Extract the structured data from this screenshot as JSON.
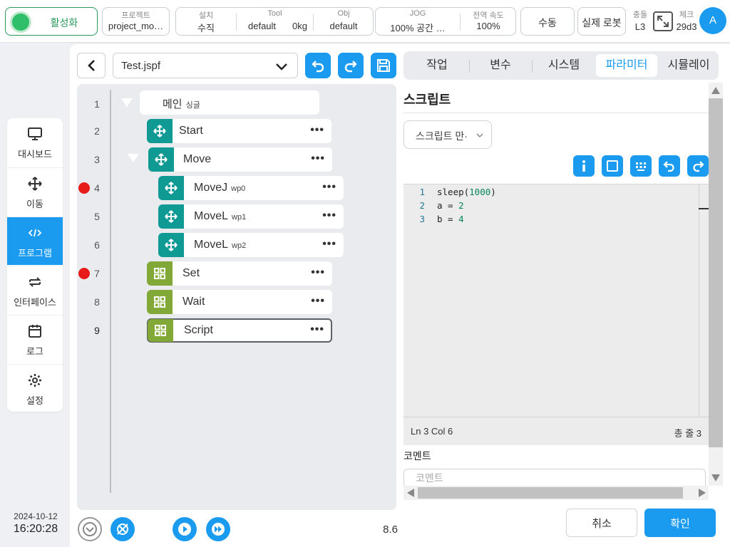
{
  "topbar": {
    "activate_label": "활성화",
    "project": {
      "label": "프로젝트",
      "value": "project_mo…"
    },
    "setup": {
      "label": "설치",
      "value": "수직"
    },
    "tool": {
      "label": "Tool",
      "value1": "default",
      "value2": "0kg"
    },
    "obj": {
      "label": "Obj",
      "value": "default"
    },
    "jog": {
      "label": "JOG",
      "value": "100%  공간 …"
    },
    "global_speed": {
      "label": "전역 속도",
      "value": "100%"
    },
    "manual_label": "수동",
    "real_robot_label": "실제 로봇",
    "collision": {
      "label": "충돌",
      "value": "L3"
    },
    "checksum": {
      "label": "체크",
      "value": "29d3"
    },
    "avatar_letter": "A",
    "colors": {
      "activate": "#2a9a5a",
      "accent": "#1a9bef"
    }
  },
  "nav": {
    "items": [
      {
        "label": "대시보드",
        "icon": "monitor-icon"
      },
      {
        "label": "이동",
        "icon": "move-icon"
      },
      {
        "label": "프로그램",
        "icon": "code-icon"
      },
      {
        "label": "인터페이스",
        "icon": "swap-icon"
      },
      {
        "label": "로그",
        "icon": "calendar-icon"
      },
      {
        "label": "설정",
        "icon": "gear-icon"
      }
    ],
    "active": "프로그램"
  },
  "datetime": {
    "date": "2024-10-12",
    "time": "16:20:28"
  },
  "editor": {
    "file_name": "Test.jspf",
    "tree": [
      {
        "line": "1",
        "name": "메인",
        "sub": "싱글",
        "type": "root"
      },
      {
        "line": "2",
        "name": "Start",
        "sub": "",
        "type": "move"
      },
      {
        "line": "3",
        "name": "Move",
        "sub": "",
        "type": "move"
      },
      {
        "line": "4",
        "name": "MoveJ",
        "sub": "wp0",
        "type": "move",
        "breakpoint": true
      },
      {
        "line": "5",
        "name": "MoveL",
        "sub": "wp1",
        "type": "move"
      },
      {
        "line": "6",
        "name": "MoveL",
        "sub": "wp2",
        "type": "move"
      },
      {
        "line": "7",
        "name": "Set",
        "sub": "",
        "type": "logic",
        "breakpoint": true
      },
      {
        "line": "8",
        "name": "Wait",
        "sub": "",
        "type": "logic"
      },
      {
        "line": "9",
        "name": "Script",
        "sub": "",
        "type": "logic",
        "selected": true
      }
    ],
    "more_label": "•••",
    "speed_value": "8.6"
  },
  "tabs": [
    "작업",
    "변수",
    "시스템",
    "파라미터",
    "시뮬레이"
  ],
  "active_tab": "파라미터",
  "script": {
    "title": "스크립트",
    "mode_value": "스크립트 만·",
    "code_lines": [
      {
        "n": "1",
        "text": "sleep(1000)"
      },
      {
        "n": "2",
        "text": "a = 2"
      },
      {
        "n": "3",
        "text": "b = 4"
      }
    ],
    "status_left": "Ln 3 Col 6",
    "status_right": "총 줄 3",
    "comment_label": "코멘트",
    "comment_placeholder": "코멘트"
  },
  "actions": {
    "cancel": "취소",
    "ok": "확인"
  }
}
